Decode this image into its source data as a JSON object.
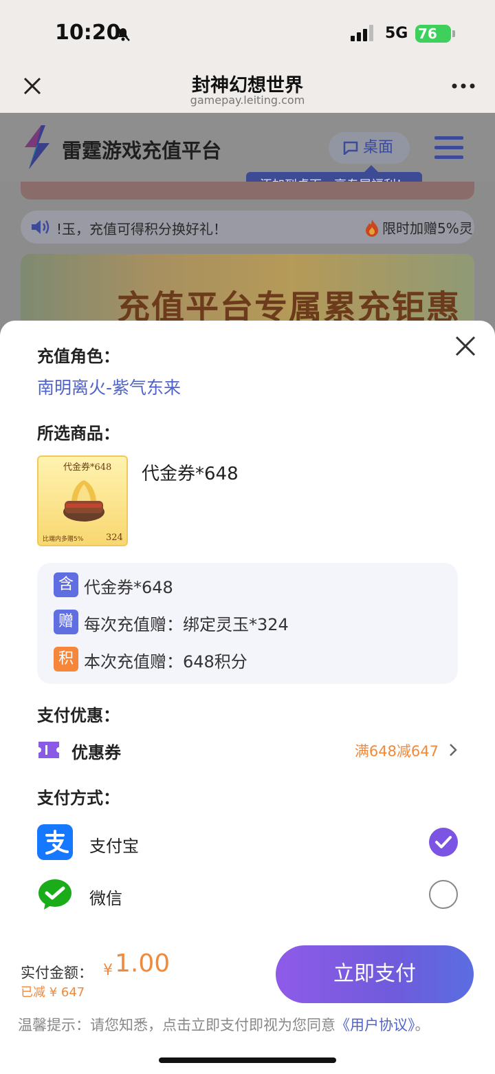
{
  "status_bar": {
    "time": "10:20",
    "network": "5G",
    "battery": "76"
  },
  "browser": {
    "title": "封神幻想世界",
    "url": "gamepay.leiting.com"
  },
  "site": {
    "name": "雷霆游戏充值平台",
    "desktop_button": "桌面",
    "tooltip": "添加到桌面，享专属福利！",
    "notice_text": "!玉，充值可得积分换好礼！",
    "notice_hot": "限时加赠5%灵",
    "banner_text": "充值平台专属累充钜惠"
  },
  "sheet": {
    "role_label": "充值角色：",
    "role_value": "南明离火-紫气东来",
    "product_label": "所选商品：",
    "product_name": "代金券*648",
    "product_image": {
      "top_text": "代金券*648",
      "bottom_left": "比端内多赠5%",
      "bottom_right": "324"
    },
    "details": [
      {
        "badge": "含",
        "text": "代金券*648",
        "color": "#5f6ee0"
      },
      {
        "badge": "赠",
        "text": "每次充值赠：绑定灵玉*324",
        "color": "#5f6ee0"
      },
      {
        "badge": "积",
        "text": "本次充值赠：648积分",
        "color": "#f6873a"
      }
    ],
    "discount_label": "支付优惠：",
    "coupon_label": "优惠券",
    "coupon_value": "满648减647",
    "payment_label": "支付方式：",
    "payment_methods": [
      {
        "name": "支付宝",
        "selected": true
      },
      {
        "name": "微信",
        "selected": false
      }
    ],
    "total_label": "实付金额：",
    "currency": "¥",
    "total_amount": "1.00",
    "saved": "已减 ¥ 647",
    "pay_button": "立即支付",
    "tip_prefix": "温馨提示：请您知悉，点击立即支付即视为您同意",
    "tip_link": "《用户协议》",
    "tip_suffix": "。"
  },
  "colors": {
    "accent": "#7b54e3",
    "link": "#4f63c9",
    "orange": "#f0893a"
  }
}
